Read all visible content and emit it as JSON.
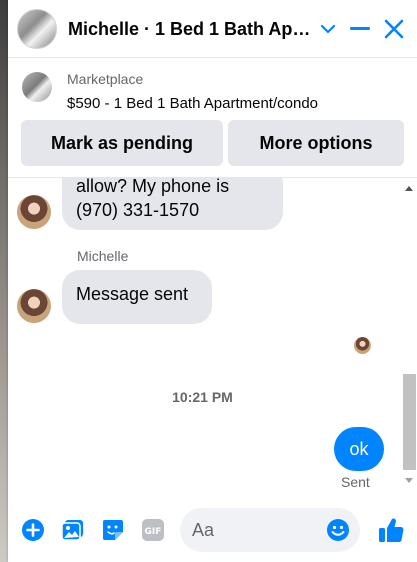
{
  "header": {
    "title": "Michelle · 1 Bed 1 Bath Apa…",
    "icons": [
      "chevron-down-icon",
      "minimize-icon",
      "close-icon"
    ]
  },
  "marketplace": {
    "label": "Marketplace",
    "listing": "$590 - 1 Bed 1 Bath Apartment/condo",
    "buttons": {
      "mark_pending": "Mark as pending",
      "more_options": "More options"
    }
  },
  "messages": {
    "incoming_1": {
      "lines": [
        "allow? My phone is",
        "(970) 331-1570"
      ]
    },
    "sender_name": "Michelle",
    "incoming_2": "Message sent",
    "timestamp": "10:21 PM",
    "outgoing_1": "ok",
    "sent_status": "Sent"
  },
  "composer": {
    "placeholder": "Aa",
    "icons": [
      "plus-icon",
      "photo-icon",
      "sticker-icon",
      "gif-icon",
      "emoji-icon",
      "like-icon"
    ]
  },
  "colors": {
    "accent": "#0084ff",
    "bubble_in": "#e4e6eb",
    "button_bg": "#e4e6eb",
    "muted_text": "#65676b"
  }
}
